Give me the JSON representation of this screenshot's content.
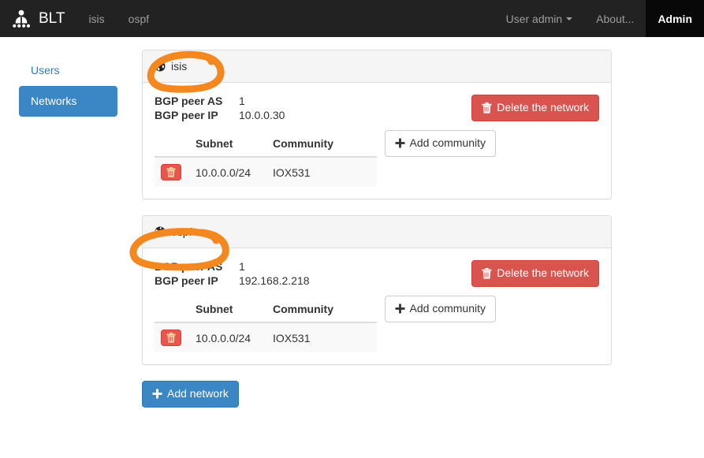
{
  "navbar": {
    "brand": "BLT",
    "brand_icon": "people-group-icon",
    "left_links": [
      {
        "label": "isis"
      },
      {
        "label": "ospf"
      }
    ],
    "right_links": [
      {
        "label": "User admin",
        "has_caret": true,
        "active": false
      },
      {
        "label": "About...",
        "has_caret": false,
        "active": false
      },
      {
        "label": "Admin",
        "has_caret": false,
        "active": true
      }
    ]
  },
  "sidebar": {
    "items": [
      {
        "label": "Users",
        "active": false
      },
      {
        "label": "Networks",
        "active": true
      }
    ]
  },
  "main": {
    "table_headers": {
      "action": "",
      "subnet": "Subnet",
      "community": "Community"
    },
    "labels": {
      "bgp_peer_as": "BGP peer AS",
      "bgp_peer_ip": "BGP peer IP"
    },
    "buttons": {
      "delete_network": "Delete the network",
      "add_community": "Add community",
      "add_network": "Add network",
      "delete_row_icon": "trash-icon",
      "delete_network_icon": "trash-icon",
      "add_community_icon": "plus-icon",
      "add_network_icon": "plus-icon"
    },
    "networks": [
      {
        "name": "isis",
        "icon": "globe-icon",
        "bgp_peer_as": "1",
        "bgp_peer_ip": "10.0.0.30",
        "rows": [
          {
            "subnet": "10.0.0.0/24",
            "community": "IOX531"
          }
        ]
      },
      {
        "name": "ospf",
        "icon": "globe-icon",
        "bgp_peer_as": "1",
        "bgp_peer_ip": "192.168.2.218",
        "rows": [
          {
            "subnet": "10.0.0.0/24",
            "community": "IOX531"
          }
        ]
      }
    ]
  },
  "annotations": {
    "color": "#f5871f",
    "marks": [
      {
        "target": "isis-panel-heading",
        "shape": "ellipse"
      },
      {
        "target": "ospf-panel-heading",
        "shape": "ellipse"
      }
    ]
  },
  "colors": {
    "navbar_bg": "#222222",
    "primary": "#3b86c5",
    "danger": "#d9534f",
    "panel_heading_bg": "#f5f5f5",
    "annotation": "#f5871f"
  }
}
